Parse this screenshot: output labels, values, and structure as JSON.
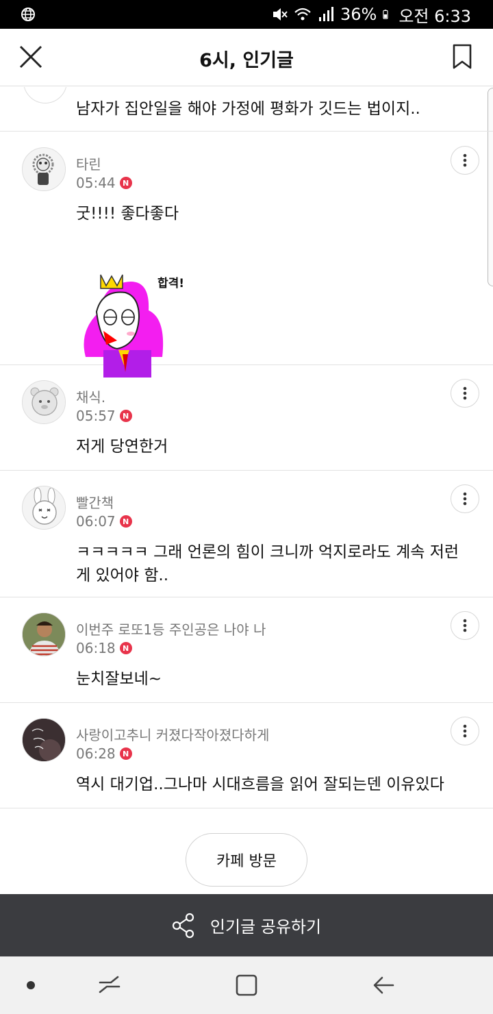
{
  "status_bar": {
    "battery": "36%",
    "time": "오전 6:33"
  },
  "header": {
    "title": "6시, 인기글"
  },
  "first_post": {
    "text": "남자가 집안일을 해야 가정에 평화가 깃드는 법이지.."
  },
  "comments": [
    {
      "nickname": "타린",
      "time": "05:44",
      "badge": "N",
      "text": "굿!!!! 좋다좋다",
      "sticker_text": "합격!"
    },
    {
      "nickname": "채식.",
      "time": "05:57",
      "badge": "N",
      "text": "저게 당연한거"
    },
    {
      "nickname": "빨간책",
      "time": "06:07",
      "badge": "N",
      "text": "ㅋㅋㅋㅋㅋ 그래 언론의 힘이 크니까 억지로라도 계속 저런 게 있어야 함.."
    },
    {
      "nickname": "이번주 로또1등 주인공은 나야 나",
      "time": "06:18",
      "badge": "N",
      "text": "눈치잘보네~"
    },
    {
      "nickname": "사랑이고추니 커졌다작아졌다하게",
      "time": "06:28",
      "badge": "N",
      "text": "역시 대기업..그나마 시대흐름을 읽어 잘되는덴 이유있다"
    }
  ],
  "visit_button": "카페 방문",
  "share_bar": {
    "label": "인기글 공유하기"
  },
  "colors": {
    "badge": "#e8344b",
    "share_bar_bg": "#3b3c40",
    "nav_bg": "#f1f1f1"
  }
}
